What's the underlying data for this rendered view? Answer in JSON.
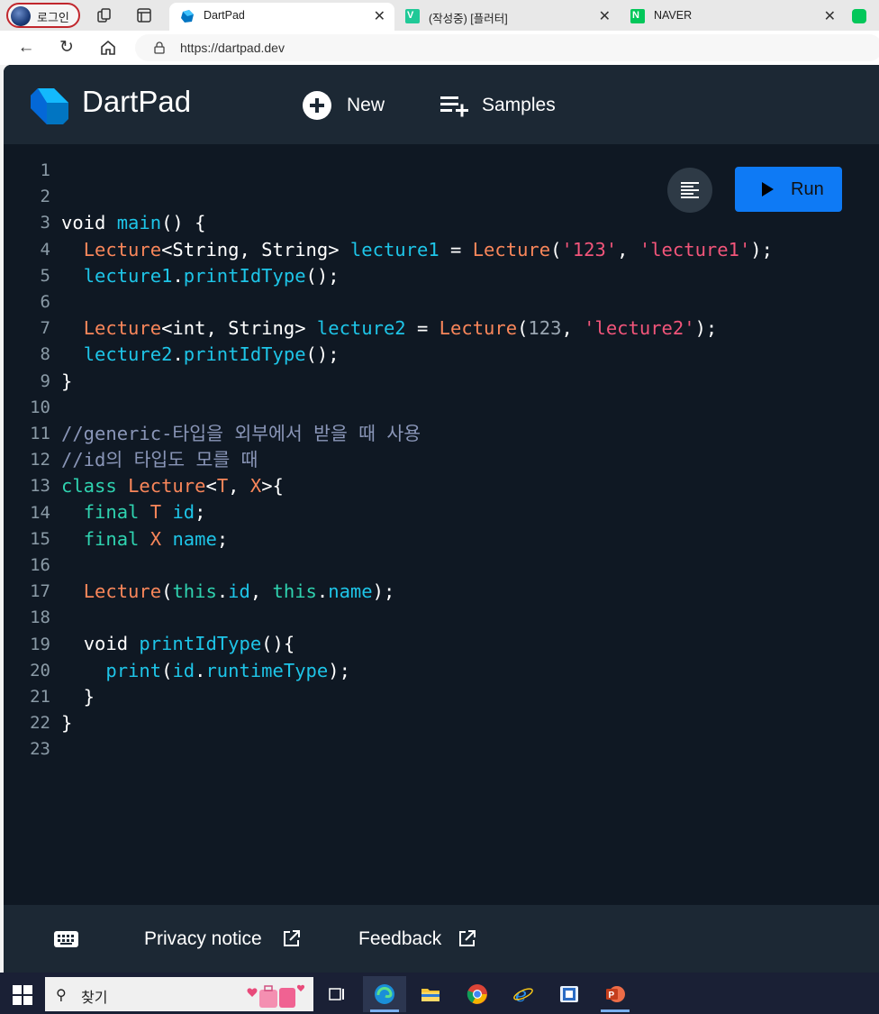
{
  "browser": {
    "profile_label": "로그인",
    "tabs": [
      {
        "title": "DartPad",
        "active": true
      },
      {
        "title": "(작성중) [플러터]",
        "active": false
      },
      {
        "title": "NAVER",
        "active": false
      }
    ],
    "url": "https://dartpad.dev"
  },
  "app": {
    "brand": "DartPad",
    "new_label": "New",
    "samples_label": "Samples",
    "run_label": "Run",
    "footer": {
      "privacy_label": "Privacy notice",
      "feedback_label": "Feedback"
    }
  },
  "editor": {
    "line_numbers": [
      "1",
      "2",
      "3",
      "4",
      "5",
      "6",
      "7",
      "8",
      "9",
      "10",
      "11",
      "12",
      "13",
      "14",
      "15",
      "16",
      "17",
      "18",
      "19",
      "20",
      "21",
      "22",
      "23"
    ],
    "lines": [
      [],
      [],
      [
        [
          "kw",
          "void "
        ],
        [
          "fn",
          "main"
        ],
        [
          "pl",
          "() {"
        ]
      ],
      [
        [
          "pl",
          "  "
        ],
        [
          "ty",
          "Lecture"
        ],
        [
          "pl",
          "<String, String> "
        ],
        [
          "fn",
          "lecture1"
        ],
        [
          "pl",
          " = "
        ],
        [
          "ty",
          "Lecture"
        ],
        [
          "pl",
          "("
        ],
        [
          "st",
          "'123'"
        ],
        [
          "pl",
          ", "
        ],
        [
          "st",
          "'lecture1'"
        ],
        [
          "pl",
          ");"
        ]
      ],
      [
        [
          "pl",
          "  "
        ],
        [
          "fn",
          "lecture1"
        ],
        [
          "pl",
          "."
        ],
        [
          "fn",
          "printIdType"
        ],
        [
          "pl",
          "();"
        ]
      ],
      [],
      [
        [
          "pl",
          "  "
        ],
        [
          "ty",
          "Lecture"
        ],
        [
          "pl",
          "<int, String> "
        ],
        [
          "fn",
          "lecture2"
        ],
        [
          "pl",
          " = "
        ],
        [
          "ty",
          "Lecture"
        ],
        [
          "pl",
          "("
        ],
        [
          "nm",
          "123"
        ],
        [
          "pl",
          ", "
        ],
        [
          "st",
          "'lecture2'"
        ],
        [
          "pl",
          ");"
        ]
      ],
      [
        [
          "pl",
          "  "
        ],
        [
          "fn",
          "lecture2"
        ],
        [
          "pl",
          "."
        ],
        [
          "fn",
          "printIdType"
        ],
        [
          "pl",
          "();"
        ]
      ],
      [
        [
          "pl",
          "}"
        ]
      ],
      [],
      [
        [
          "cm",
          "//generic-타입을 외부에서 받을 때 사용"
        ]
      ],
      [
        [
          "cm",
          "//id의 타입도 모를 때"
        ]
      ],
      [
        [
          "cl",
          "class "
        ],
        [
          "ty",
          "Lecture"
        ],
        [
          "pl",
          "<"
        ],
        [
          "ty",
          "T"
        ],
        [
          "pl",
          ", "
        ],
        [
          "ty",
          "X"
        ],
        [
          "pl",
          ">{"
        ]
      ],
      [
        [
          "pl",
          "  "
        ],
        [
          "cl",
          "final "
        ],
        [
          "ty",
          "T "
        ],
        [
          "fn",
          "id"
        ],
        [
          "pl",
          ";"
        ]
      ],
      [
        [
          "pl",
          "  "
        ],
        [
          "cl",
          "final "
        ],
        [
          "ty",
          "X "
        ],
        [
          "fn",
          "name"
        ],
        [
          "pl",
          ";"
        ]
      ],
      [],
      [
        [
          "pl",
          "  "
        ],
        [
          "ty",
          "Lecture"
        ],
        [
          "pl",
          "("
        ],
        [
          "cl",
          "this"
        ],
        [
          "pl",
          "."
        ],
        [
          "fn",
          "id"
        ],
        [
          "pl",
          ", "
        ],
        [
          "cl",
          "this"
        ],
        [
          "pl",
          "."
        ],
        [
          "fn",
          "name"
        ],
        [
          "pl",
          ");"
        ]
      ],
      [],
      [
        [
          "pl",
          "  "
        ],
        [
          "kw",
          "void "
        ],
        [
          "fn",
          "printIdType"
        ],
        [
          "pl",
          "(){"
        ]
      ],
      [
        [
          "pl",
          "    "
        ],
        [
          "fn",
          "print"
        ],
        [
          "pl",
          "("
        ],
        [
          "fn",
          "id"
        ],
        [
          "pl",
          "."
        ],
        [
          "fn",
          "runtimeType"
        ],
        [
          "pl",
          ");"
        ]
      ],
      [
        [
          "pl",
          "  }"
        ]
      ],
      [
        [
          "pl",
          "}"
        ]
      ],
      []
    ]
  },
  "taskbar": {
    "search_placeholder": "찾기"
  }
}
